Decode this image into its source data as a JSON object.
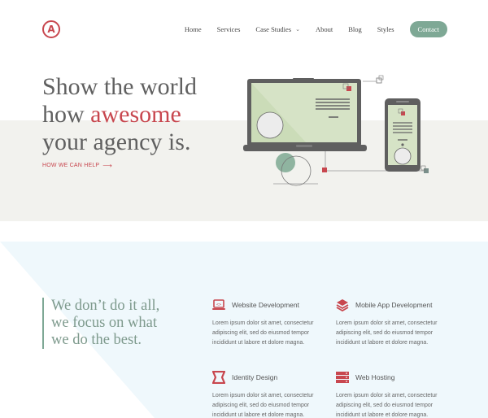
{
  "header": {
    "logo_letter": "A",
    "nav": [
      {
        "label": "Home"
      },
      {
        "label": "Services"
      },
      {
        "label": "Case Studies"
      },
      {
        "label": "About"
      },
      {
        "label": "Blog"
      },
      {
        "label": "Styles"
      }
    ],
    "contact_label": "Contact"
  },
  "hero": {
    "title_line1": "Show the world",
    "title_line2_pre": "how ",
    "title_line2_highlight": "awesome",
    "title_line3": "your agency is.",
    "cta_label": "HOW WE CAN HELP",
    "cta_arrow": "⟶"
  },
  "services": {
    "tagline": [
      "We don’t do it all,",
      "we focus on what",
      "we do the best."
    ],
    "items": [
      {
        "icon": "laptop-code-icon",
        "title": "Website Development",
        "desc": "Lorem ipsum dolor sit amet, consectetur adipiscing elit, sed do eiusmod tempor incididunt ut labore et dolore magna."
      },
      {
        "icon": "layers-icon",
        "title": "Mobile App Development",
        "desc": "Lorem ipsum dolor sit amet, consectetur adipiscing elit, sed do eiusmod tempor incididunt ut labore et dolore magna."
      },
      {
        "icon": "frame-icon",
        "title": "Identity Design",
        "desc": "Lorem ipsum dolor sit amet, consectetur adipiscing elit, sed do eiusmod tempor incididunt ut labore et dolore magna."
      },
      {
        "icon": "server-icon",
        "title": "Web Hosting",
        "desc": "Lorem ipsum dolor sit amet, consectetur adipiscing elit, sed do eiusmod tempor incididunt ut labore et dolore magna."
      }
    ]
  },
  "colors": {
    "accent": "#c8474f",
    "green": "#7ea895",
    "hero_band": "#f2f2ee",
    "section_bg": "#eff8fc"
  }
}
